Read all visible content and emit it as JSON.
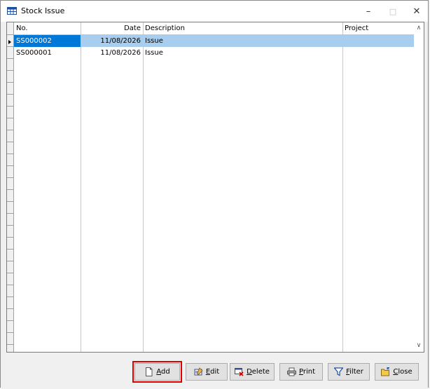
{
  "window": {
    "title": "Stock Issue",
    "icon": "grid-window-icon",
    "controls": {
      "minimize": "–",
      "maximize": "□",
      "close": "✕"
    }
  },
  "grid": {
    "columns": [
      "No.",
      "Date",
      "Description",
      "Project"
    ],
    "rows": [
      {
        "no": "SS000002",
        "date": "11/08/2026",
        "description": "Issue",
        "project": "",
        "selected": true
      },
      {
        "no": "SS000001",
        "date": "11/08/2026",
        "description": "Issue",
        "project": "",
        "selected": false
      }
    ],
    "scroll_up": "∧",
    "scroll_down": "∨"
  },
  "toolbar": {
    "buttons": [
      {
        "label": "Add",
        "underline": "A",
        "rest": "dd",
        "icon": "new-document-icon",
        "highlighted": true
      },
      {
        "label": "Edit",
        "underline": "E",
        "rest": "dit",
        "icon": "edit-icon"
      },
      {
        "label": "Delete",
        "underline": "D",
        "rest": "elete",
        "icon": "delete-icon"
      },
      {
        "label": "Print",
        "underline": "P",
        "rest": "rint",
        "icon": "printer-icon"
      },
      {
        "label": "Filter",
        "underline": "F",
        "rest": "ilter",
        "icon": "filter-icon"
      },
      {
        "label": "Close",
        "underline": "C",
        "rest": "lose",
        "icon": "folder-open-icon"
      }
    ]
  },
  "colors": {
    "selection": "#a8cdef",
    "focus": "#0078d7",
    "highlight_border": "#e00000"
  }
}
